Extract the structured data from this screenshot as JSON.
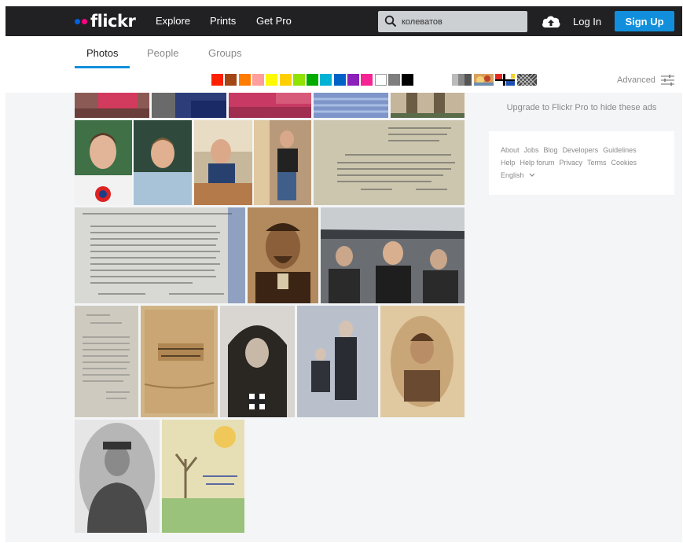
{
  "header": {
    "logo_text": "flickr",
    "nav": [
      {
        "label": "Explore"
      },
      {
        "label": "Prints"
      },
      {
        "label": "Get Pro"
      }
    ],
    "search": {
      "value": "колеватов",
      "placeholder": ""
    },
    "login_label": "Log In",
    "signup_label": "Sign Up",
    "colors": {
      "bar": "#212124",
      "accent": "#128fdc"
    }
  },
  "tabs": [
    {
      "label": "Photos",
      "active": true
    },
    {
      "label": "People",
      "active": false
    },
    {
      "label": "Groups",
      "active": false
    }
  ],
  "color_filters": [
    "#ff2000",
    "#a24615",
    "#ff7c00",
    "#ff9f9c",
    "#fffa00",
    "#ffcf00",
    "#90e200",
    "#00ab00",
    "#00b2d4",
    "#0062c6",
    "#8c20ba",
    "#f52394",
    "#ffffff",
    "#7e7e7e",
    "#000000"
  ],
  "style_filters": [
    "black-and-white-icon",
    "shallow-depth-icon",
    "minimalism-icon",
    "patterns-icon"
  ],
  "advanced_label": "Advanced",
  "sidebar": {
    "upgrade_text": "Upgrade to Flickr Pro to hide these ads",
    "footer_row1": [
      "About",
      "Jobs",
      "Blog",
      "Developers",
      "Guidelines"
    ],
    "footer_row2": [
      "Help",
      "Help forum",
      "Privacy",
      "Terms",
      "Cookies"
    ],
    "language": "English"
  },
  "photos": [
    {
      "id": "red-shirt-1"
    },
    {
      "id": "blue-crop"
    },
    {
      "id": "red-shirt-2"
    },
    {
      "id": "blue-cloth"
    },
    {
      "id": "legs"
    },
    {
      "id": "young-man-tshirt"
    },
    {
      "id": "young-man-blue-shirt"
    },
    {
      "id": "boy-at-table"
    },
    {
      "id": "boys-seated"
    },
    {
      "id": "handwritten-letter"
    },
    {
      "id": "typed-document"
    },
    {
      "id": "sepia-man-portrait"
    },
    {
      "id": "pilots-cockpit"
    },
    {
      "id": "old-booklet-page"
    },
    {
      "id": "old-book-cover"
    },
    {
      "id": "nurse-portrait"
    },
    {
      "id": "man-and-child"
    },
    {
      "id": "oval-woman-portrait"
    },
    {
      "id": "soldier-portrait"
    },
    {
      "id": "child-drawing"
    }
  ]
}
